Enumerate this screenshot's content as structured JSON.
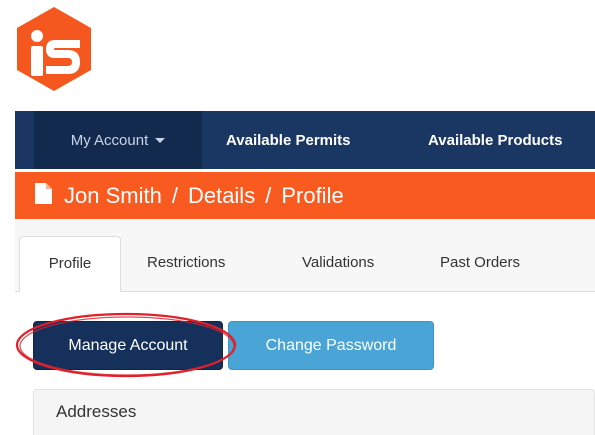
{
  "logo": {
    "icon": "app-logo",
    "color": "#f5581f"
  },
  "navbar": {
    "items": [
      {
        "label": "My Account",
        "icon": "caret-down-icon"
      },
      {
        "label": "Available Permits"
      },
      {
        "label": "Available Products"
      }
    ],
    "background": "#1a3662"
  },
  "breadcrumb": {
    "icon": "document-icon",
    "items": [
      "Jon Smith",
      "Details",
      "Profile"
    ],
    "separator": "/",
    "background": "#f85a20"
  },
  "tabs": [
    {
      "label": "Profile",
      "active": true
    },
    {
      "label": "Restrictions"
    },
    {
      "label": "Validations"
    },
    {
      "label": "Past Orders"
    }
  ],
  "buttons": {
    "manage_account": "Manage Account",
    "change_password": "Change Password"
  },
  "panel": {
    "title": "Addresses"
  },
  "colors": {
    "primary_button": "#15305a",
    "info_button": "#4aa5d6",
    "highlight": "#e0202a"
  }
}
